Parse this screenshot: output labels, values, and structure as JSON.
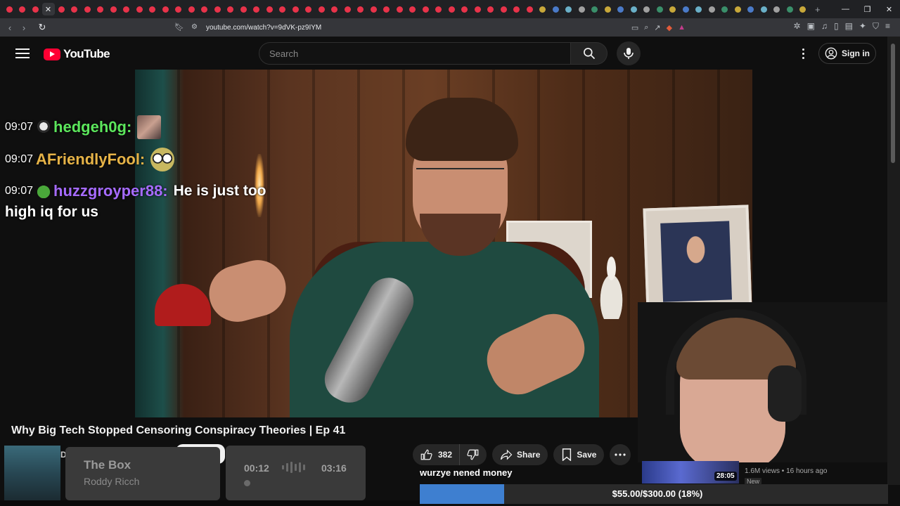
{
  "browser": {
    "tab_count": 62,
    "active_tab_close": "✕",
    "new_tab": "+",
    "url": "youtube.com/watch?v=9dVK-pz9IYM"
  },
  "youtube": {
    "logo_text": "YouTube",
    "search_placeholder": "Search",
    "signin_label": "Sign in"
  },
  "chat": [
    {
      "time": "09:07",
      "user": "hedgeh0g:",
      "color": "#5ce65c",
      "message": ""
    },
    {
      "time": "09:07",
      "user": "AFriendlyFool:",
      "color": "#e6b347",
      "message": ""
    },
    {
      "time": "09:07",
      "user": "huzzgroyper88:",
      "color": "#a66bff",
      "message": "He is just too",
      "message_cont": "high iq for us"
    }
  ],
  "video": {
    "title": "Why Big Tech Stopped Censoring Conspiracy Theories | Ep 41",
    "like_count": "382",
    "share_label": "Share",
    "save_label": "Save"
  },
  "song": {
    "prefix": "D",
    "title": "The Box",
    "artist": "Roddy Ricch",
    "current": "00:12",
    "total": "03:16"
  },
  "donation": {
    "label": "wurzye nened money",
    "text": "$55.00/$300.00 (18%)",
    "progress": 0.18
  },
  "related": {
    "duration": "28:05",
    "meta": "1.6M views • 16 hours ago",
    "badge": "New"
  }
}
